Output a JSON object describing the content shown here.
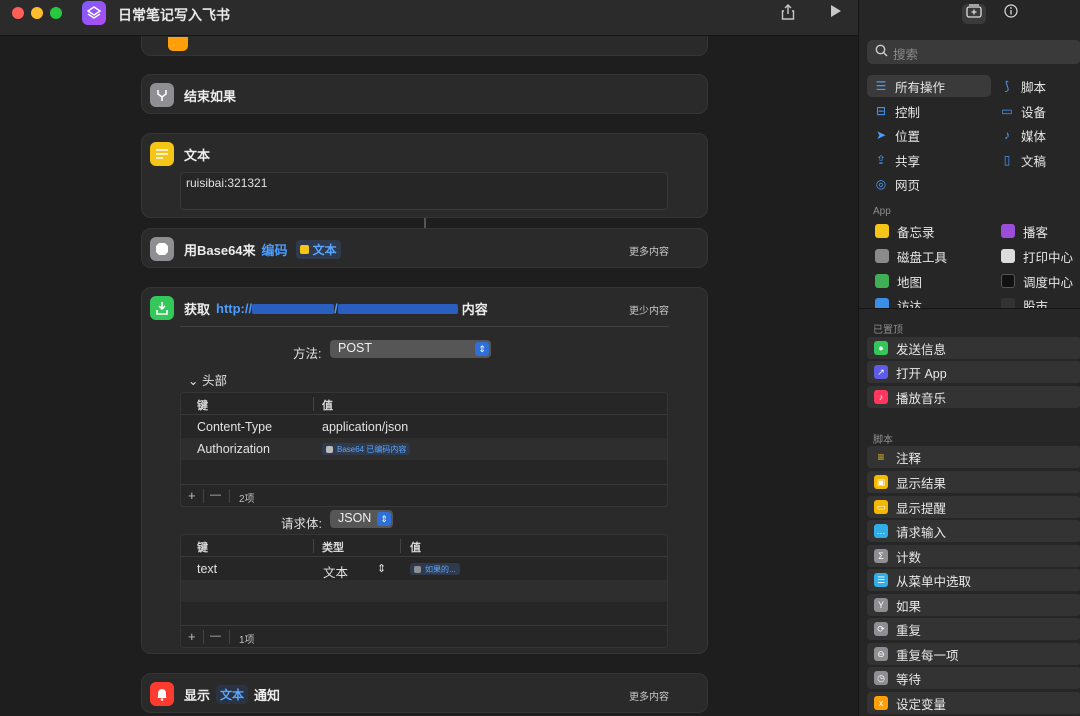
{
  "window": {
    "title": "日常笔记写入飞书",
    "share_icon": "share-icon",
    "run_icon": "play-icon"
  },
  "actions": {
    "end_if": {
      "title": "结束如果"
    },
    "text": {
      "title": "文本",
      "content": "ruisibai:321321"
    },
    "base64": {
      "prefix": "用Base64来",
      "mode": "编码",
      "input": "文本",
      "more": "更多内容"
    },
    "get": {
      "prefix": "获取",
      "url_start": "http://",
      "url_mid": "/",
      "suffix": "内容",
      "more": "更少内容",
      "method_label": "方法:",
      "method_value": "POST",
      "headers_label": "头部",
      "headers": {
        "col_key": "键",
        "col_value": "值",
        "rows": [
          {
            "key": "Content-Type",
            "value": "application/json"
          },
          {
            "key": "Authorization",
            "value": "Base64 已编码内容"
          }
        ],
        "add": "+",
        "remove": "—",
        "count": "2项"
      },
      "body_label": "请求体:",
      "body_value": "JSON",
      "body": {
        "col_key": "键",
        "col_type": "类型",
        "col_value": "值",
        "rows": [
          {
            "key": "text",
            "type": "文本",
            "value": "如果的..."
          }
        ],
        "add": "+",
        "remove": "—",
        "count": "1项"
      }
    },
    "notify": {
      "prefix": "显示",
      "token": "文本",
      "suffix": "通知",
      "more": "更多内容"
    }
  },
  "sidebar": {
    "search_placeholder": "搜索",
    "categories": [
      {
        "label": "所有操作",
        "icon": "list-icon",
        "selected": true
      },
      {
        "label": "脚本",
        "icon": "script-icon"
      },
      {
        "label": "控制",
        "icon": "toggle-icon"
      },
      {
        "label": "设备",
        "icon": "display-icon"
      },
      {
        "label": "位置",
        "icon": "location-icon"
      },
      {
        "label": "媒体",
        "icon": "music-note-icon"
      },
      {
        "label": "共享",
        "icon": "share-icon"
      },
      {
        "label": "文稿",
        "icon": "document-icon"
      },
      {
        "label": "网页",
        "icon": "compass-icon"
      }
    ],
    "app_section": "App",
    "apps": [
      {
        "label": "备忘录",
        "color": "#f5c518"
      },
      {
        "label": "播客",
        "color": "#9b4fd8"
      },
      {
        "label": "磁盘工具",
        "color": "#8a8a8a"
      },
      {
        "label": "打印中心",
        "color": "#dddddd"
      },
      {
        "label": "地图",
        "color": "#3fae55"
      },
      {
        "label": "调度中心",
        "color": "#222222"
      },
      {
        "label": "访达",
        "color": "#3a8ee6"
      },
      {
        "label": "股市",
        "color": "#333333"
      }
    ],
    "pinned_section": "已置顶",
    "pinned": [
      {
        "label": "发送信息",
        "color": "#34c759"
      },
      {
        "label": "打开 App",
        "color": "#5e5ce6"
      },
      {
        "label": "播放音乐",
        "color": "#ff375f"
      }
    ],
    "script_section": "脚本",
    "scripts": [
      {
        "label": "注释",
        "color": "#f5c518"
      },
      {
        "label": "显示结果",
        "color": "#f5b800"
      },
      {
        "label": "显示提醒",
        "color": "#f5b800"
      },
      {
        "label": "请求输入",
        "color": "#32ade6"
      },
      {
        "label": "计数",
        "color": "#8e8e93"
      },
      {
        "label": "从菜单中选取",
        "color": "#32ade6"
      },
      {
        "label": "如果",
        "color": "#8e8e93"
      },
      {
        "label": "重复",
        "color": "#8e8e93"
      },
      {
        "label": "重复每一项",
        "color": "#8e8e93"
      },
      {
        "label": "等待",
        "color": "#8e8e93"
      },
      {
        "label": "设定变量",
        "color": "#ff9f0a"
      }
    ]
  }
}
